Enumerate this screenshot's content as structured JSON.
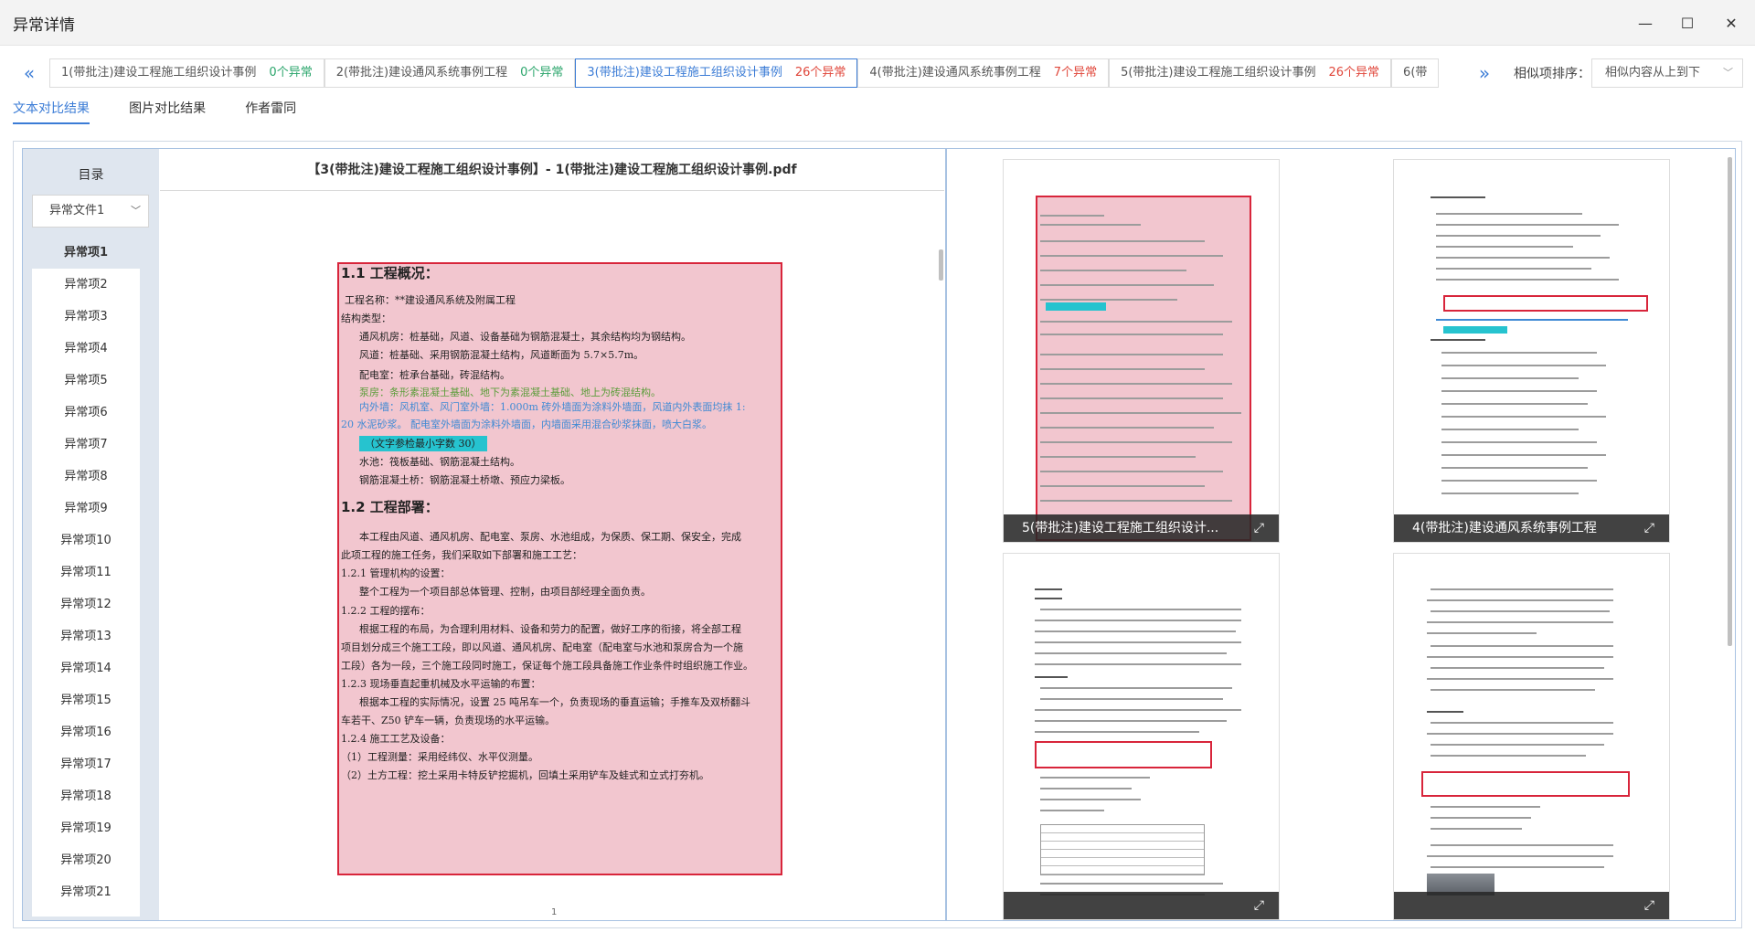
{
  "window": {
    "title": "异常详情",
    "min": "—",
    "max": "☐",
    "close": "✕"
  },
  "tabs": [
    {
      "label": "1(带批注)建设工程施工组织设计事例",
      "count": "0个异常",
      "tone": "green"
    },
    {
      "label": "2(带批注)建设通风系统事例工程",
      "count": "0个异常",
      "tone": "green"
    },
    {
      "label": "3(带批注)建设工程施工组织设计事例",
      "count": "26个异常",
      "tone": "red"
    },
    {
      "label": "4(带批注)建设通风系统事例工程",
      "count": "7个异常",
      "tone": "red"
    },
    {
      "label": "5(带批注)建设工程施工组织设计事例",
      "count": "26个异常",
      "tone": "red"
    },
    {
      "label": "6(带",
      "count": "",
      "tone": "red"
    }
  ],
  "nav": {
    "prev": "«",
    "next": "»"
  },
  "sort": {
    "label": "相似项排序：",
    "value": "相似内容从上到下"
  },
  "subtabs": [
    "文本对比结果",
    "图片对比结果",
    "作者雷同"
  ],
  "toc": {
    "title": "目录",
    "file_select": "异常文件1",
    "items": [
      "异常项1",
      "异常项2",
      "异常项3",
      "异常项4",
      "异常项5",
      "异常项6",
      "异常项7",
      "异常项8",
      "异常项9",
      "异常项10",
      "异常项11",
      "异常项12",
      "异常项13",
      "异常项14",
      "异常项15",
      "异常项16",
      "异常项17",
      "异常项18",
      "异常项19",
      "异常项20",
      "异常项21"
    ]
  },
  "doc": {
    "header": "【3(带批注)建设工程施工组织设计事例】- 1(带批注)建设工程施工组织设计事例.pdf",
    "page_mark": "1",
    "h1": "1.1 工程概况：",
    "l1": "工程名称：**建设通风系统及附属工程",
    "l2": "结构类型：",
    "l3": "通风机房：桩基础，风道、设备基础为钢筋混凝土，其余结构均为钢结构。",
    "l4": "风道：桩基础、采用钢筋混凝土结构，风道断面为 5.7×5.7m。",
    "l5": "配电室：桩承台基础，砖混结构。",
    "l6": "泵房：条形素混凝土基础、地下为素混凝土基础、地上为砖混结构。",
    "l7": "内外墙：风机室、风门室外墙：1.000m 砖外墙面为涂料外墙面，风道内外表面均抹 1:",
    "l8": "20 水泥砂浆。 配电室外墙面为涂料外墙面，内墙面采用混合砂浆抹面，喷大白浆。",
    "chip": "（文字参检最小字数 30）",
    "l9": "水池：筏板基础、钢筋混凝土结构。",
    "l10": "钢筋混凝土桥：钢筋混凝土桥墩、预应力梁板。",
    "h2": "1.2 工程部署：",
    "l11": "本工程由风道、通风机房、配电室、泵房、水池组成，为保质、保工期、保安全，完成",
    "l12": "此项工程的施工任务，我们采取如下部署和施工工艺：",
    "l13": "1.2.1 管理机构的设置：",
    "l14": "整个工程为一个项目部总体管理、控制，由项目部经理全面负责。",
    "l15": "1.2.2 工程的摆布：",
    "l16": "根据工程的布局，为合理利用材料、设备和劳力的配置，做好工序的衔接，将全部工程",
    "l17": "项目划分成三个施工工段，即以风道、通风机房、配电室（配电室与水池和泵房合为一个施",
    "l18": "工段）各为一段，三个施工段同时施工，保证每个施工段具备施工作业条件时组织施工作业。",
    "l19": "1.2.3 现场垂直起重机械及水平运输的布置：",
    "l20": "根据本工程的实际情况，设置 25 吨吊车一个，负责现场的垂直运输；手推车及双桥翻斗",
    "l21": "车若干、Z50 铲车一辆，负责现场的水平运输。",
    "l22": "1.2.4 施工工艺及设备：",
    "l23": "（1）工程测量：采用经纬仪、水平仪测量。",
    "l24": "（2）土方工程：挖土采用卡特反铲挖掘机，回填土采用铲车及蛙式和立式打夯机。"
  },
  "thumbs": [
    {
      "caption": "5(带批注)建设工程施工组织设计...",
      "fs": "⤢"
    },
    {
      "caption": "4(带批注)建设通风系统事例工程",
      "fs": "⤢"
    },
    {
      "caption": "",
      "fs": "⤢"
    },
    {
      "caption": "",
      "fs": "⤢"
    }
  ],
  "colors": {
    "accent": "#3b7cd6",
    "highlight": "#f2c6cf",
    "frame": "#d8253b",
    "ok": "#2aa56b",
    "bad": "#e0463a"
  }
}
